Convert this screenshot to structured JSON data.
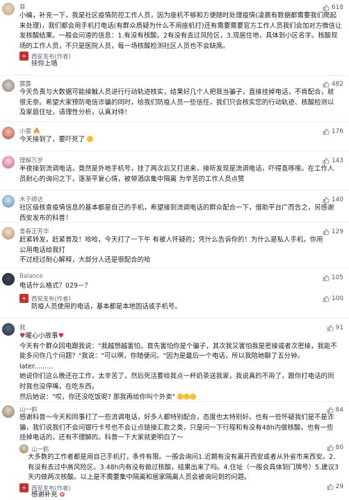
{
  "comments": [
    {
      "name": "菲",
      "likes": "618",
      "body": [
        "小编，补充一下，我是社区疫情防控工作人员，因为座机不够和方便随时处理疫情(凌晨有数据都需要我们爬起",
        "来处理)，我们都会用手机打电话(有群众质疑为什么不用座机打)还有需要需要官方工作人员我们会加对方微信让",
        "发核酸结果。一般会问道的信息：1.有没有核酸。2有没有去过风险区，3.现居住地，具体到小区名字。核酸现",
        "场的工作人员，不只是医院人员，每一场核酸检测社区人员也不会缺席。"
      ],
      "reply": {
        "name": "西安发布(作者)",
        "text": "扶你上墙"
      }
    },
    {
      "name": "露露",
      "likes": "482",
      "body": [
        "今天负责与大数据可能接触人员进行行动轨迹核实，结果好几个人把我当骗子，直接挂掉电话，不肯配合，就",
        "很无奈。希望大家预防电信诈骗的同时，给我们防疫人员一些信任，我们只会核实您的行动轨迹、核酸检测以",
        "及家庭住址，请理性分析，认真对待！"
      ]
    },
    {
      "name": "小蛋",
      "likes": "176",
      "body": [
        "今天接到了，要吓死了"
      ]
    },
    {
      "name": "理解万岁",
      "likes": "143",
      "body": [
        "半夜接到流调电话，竟然是外地手机号，挂了两次后又打进来，接听发现是流调电话，吓得直哆嗦。在工作人",
        "员耐心的询问之下，逐渐平复心情，被带酒店集中隔离  为辛苦的工作人员点赞"
      ]
    },
    {
      "name": "木子師达",
      "likes": "140",
      "body": [
        "社区级核查疫情信息的基本都是自己的手机，希望接到流调电话的群众配合一下，借助平台广而告之，另感谢",
        "西安发布的科普！"
      ]
    },
    {
      "name": "青春正芳华",
      "likes": "129",
      "body": [
        "赶紧转发，赶紧普及！哈哈，今天打了一下午  有被人怀疑的；凭什么告诉你的！为什么是私人手机，你用",
        "公用电话给我打",
        "不过经过耐心解释，大部分人还是很配合的哈"
      ]
    },
    {
      "name": "Balance",
      "likes": "105",
      "body": [
        "电话什么格式？029－？"
      ],
      "reply": {
        "name": "西安发布(作者)",
        "text": "防疫人员使用的电话，基本都是本地固话或手机号。",
        "likes": "100"
      }
    },
    {
      "name": "我",
      "likes": "91",
      "body": [
        "暖心小故事",
        "今天有个群众回电跟我说：\"我越想越害怕，首先害怕你是个骗子，其次我又害怕我是密接或者次密接，我能不",
        "能多问你几个问题？\"我说：\"可以啊，你随便问。\"因为是最后一个电话，所以我陪她聊了五分钟。",
        "later.........",
        "她说你们这么晚还在工作，太辛苦了，然后死活要给我点一杯奶茶送我家，我说真的不用了，跟你打电话的同",
        "时我也没停嘴，在吃东西。",
        "然后她说：\"哎，你还没吃饭呢? 那我再给你叫个外卖\""
      ]
    },
    {
      "name": "山一鹤",
      "likes": "84",
      "body": [
        "感谢科普～今天和同事打了一些流调电话，好多人都特别配合，态度也太特别好。也有一些怀疑我们是不是诈",
        "骗，我们说我们不会问银行卡号也不会让点链接汇款之类，只是问一下行程和有没有48h内做核酸。也有一些",
        "挂掉电话的，还有不理解的。科普一下大家就更明白了～"
      ],
      "reply": {
        "name": "山一鹤",
        "likes": "80",
        "lines": [
          "大多数的工作者都是用自己手机打，条件有限。一般会询问1.近期有没有离开西安或者从外省市来西安。2.",
          "有没有去过中高风险区。3.48h内有没有做过核酸，结果出来了吗。4.住址（一般会具体到门牌号）5.建议3",
          "天内做两次核酸。以上是不需要集中隔离和居家隔离人员会被询问到的问题。"
        ]
      },
      "reply2": {
        "name": "西安发布(作者)",
        "text": "感谢补充",
        "likes": "29"
      }
    }
  ],
  "icons": {
    "like": "thumb-up-icon",
    "author_badge": "xian-release-badge-icon"
  },
  "colors": {
    "name": "#6a6a6a",
    "reply_name": "#5a6c89",
    "badge": "#c8302e",
    "divider": "#eeeeee"
  }
}
